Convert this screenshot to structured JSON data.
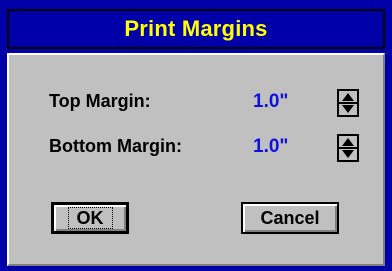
{
  "dialog": {
    "title": "Print Margins",
    "fields": [
      {
        "label": "Top Margin:",
        "value": "1.0\""
      },
      {
        "label": "Bottom Margin:",
        "value": "1.0\""
      }
    ],
    "buttons": {
      "ok_label": "OK",
      "cancel_label": "Cancel"
    }
  },
  "colors": {
    "title_bar_background": "#0000a8",
    "title_text": "#ffff00",
    "panel_background": "#c0c0c0",
    "value_text": "#1010e0"
  },
  "icons": {
    "spinner": "up-down-spinner-icon"
  }
}
